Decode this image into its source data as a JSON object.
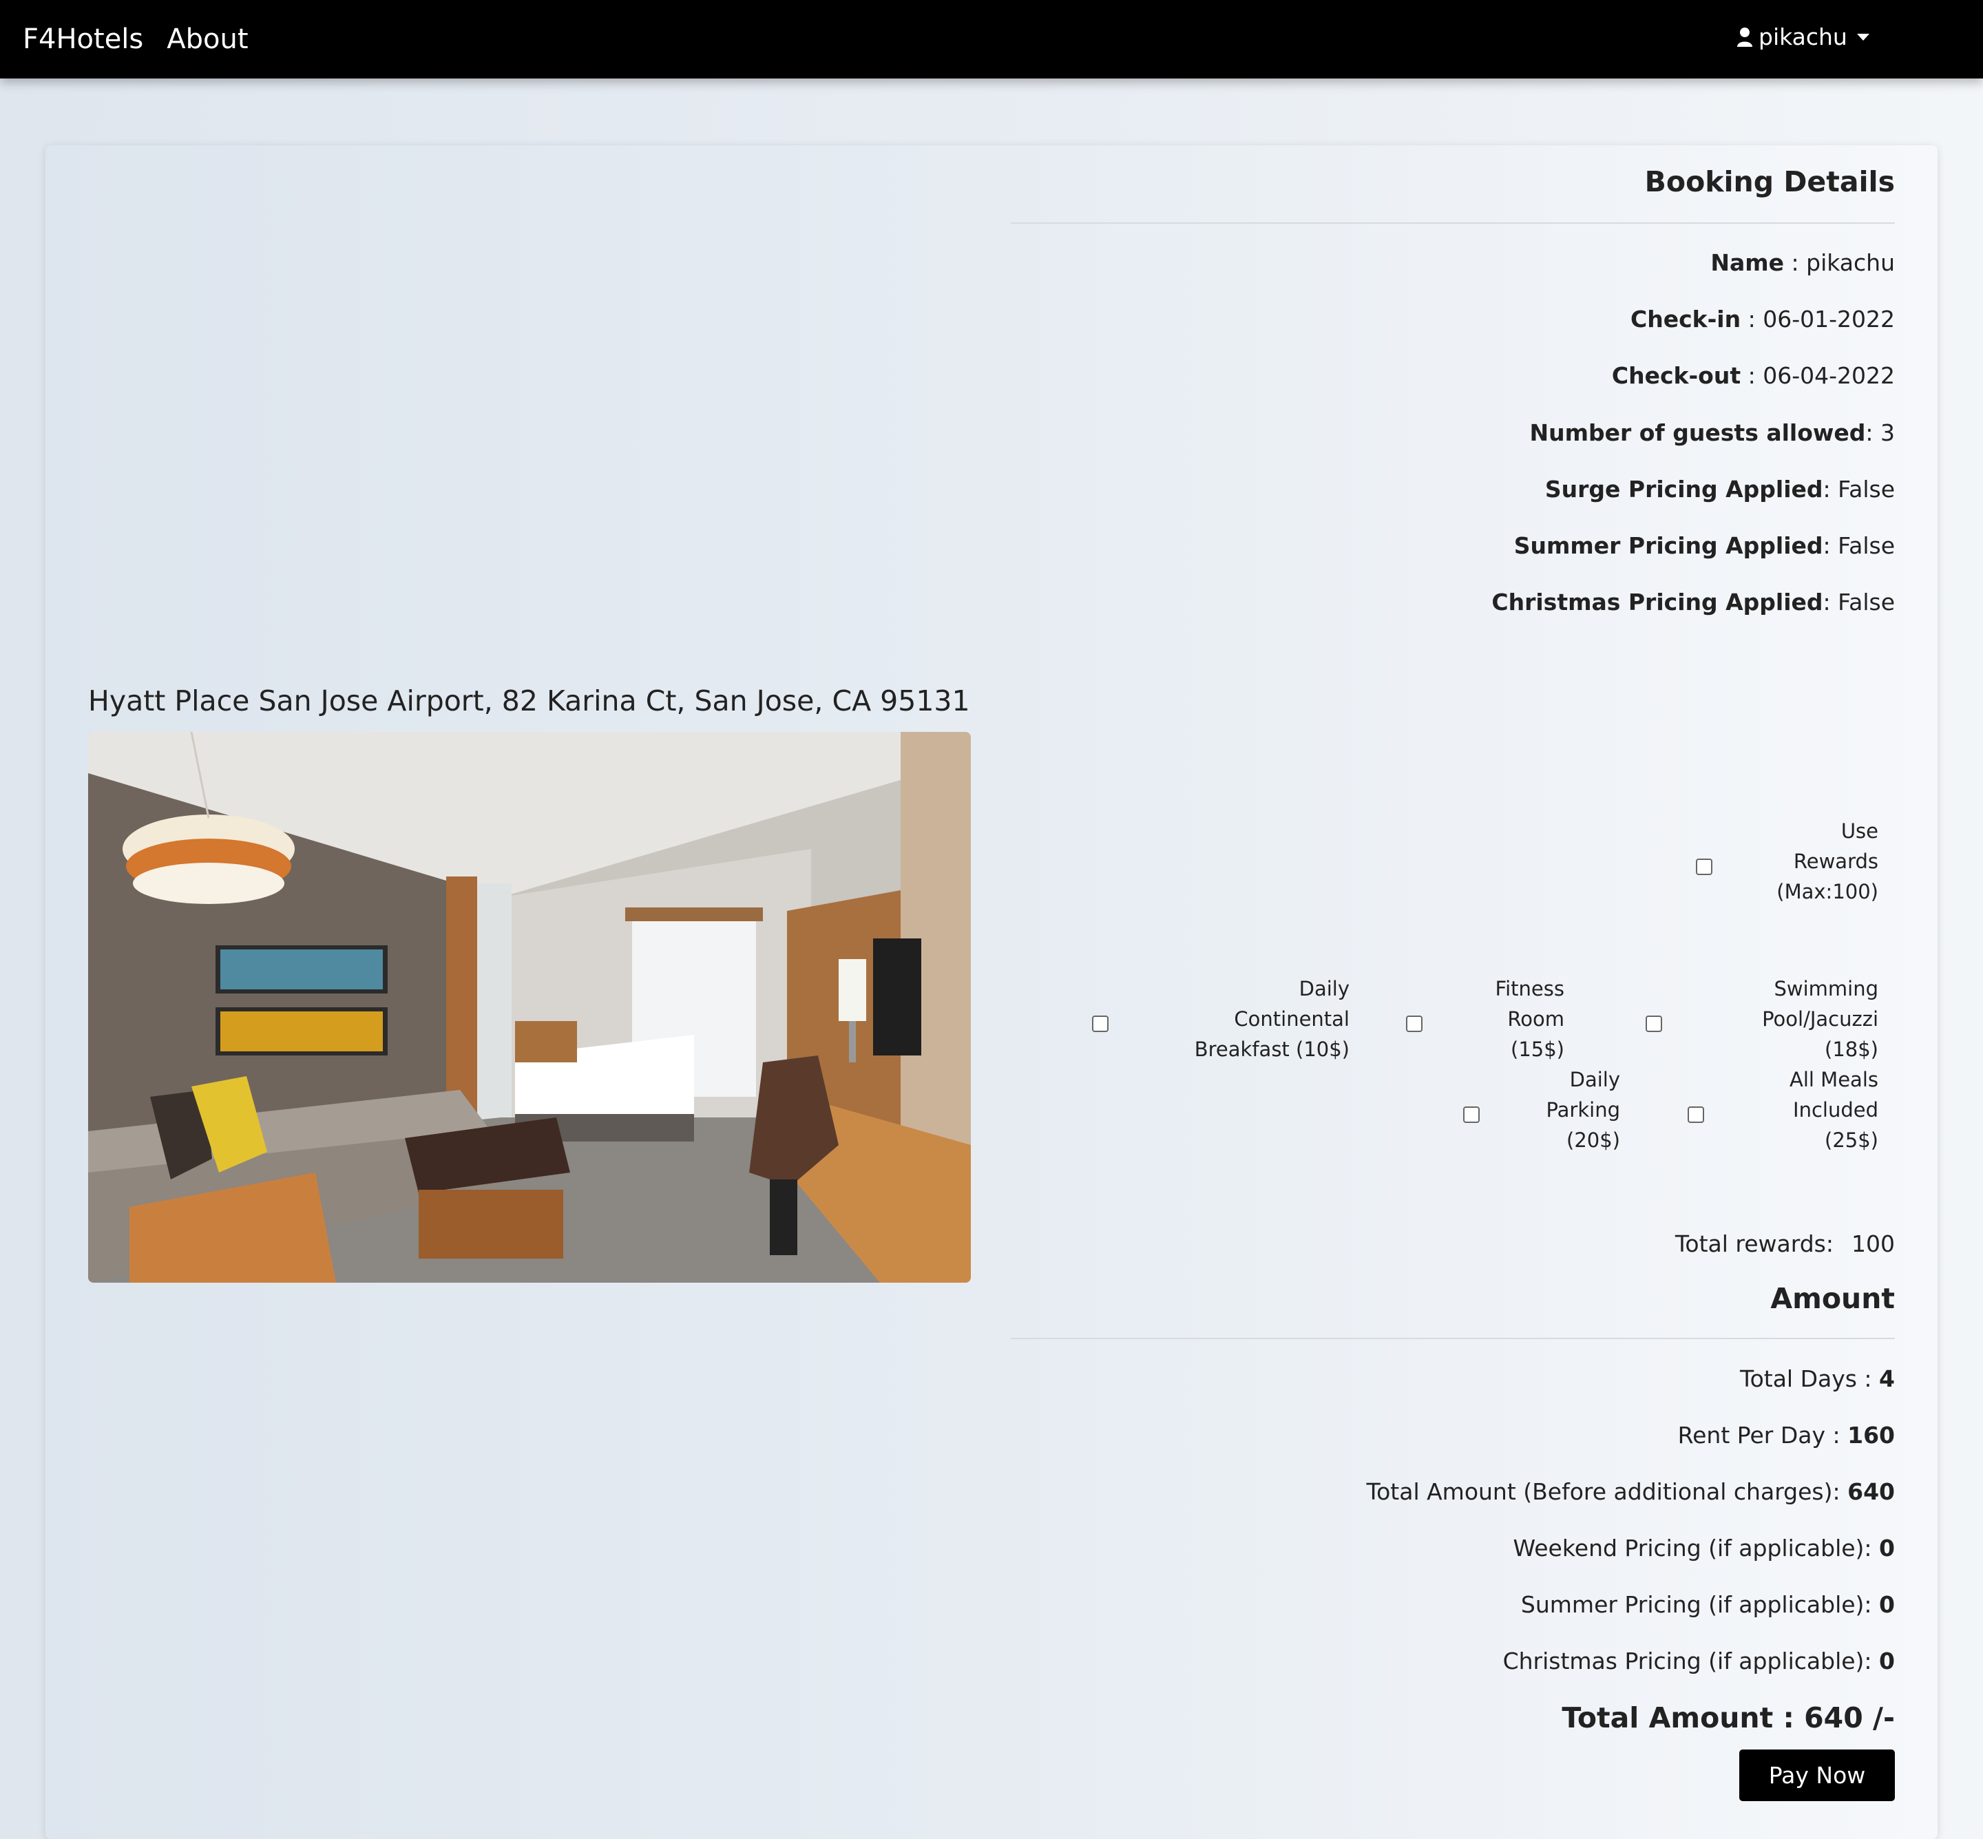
{
  "nav": {
    "brand": "F4Hotels",
    "about": "About",
    "user": "pikachu"
  },
  "hotel": {
    "title": "Hyatt Place San Jose Airport, 82 Karina Ct, San Jose, CA 95131"
  },
  "booking": {
    "heading": "Booking Details",
    "name_label": "Name",
    "name_value": " : pikachu",
    "checkin_label": "Check-in",
    "checkin_value": " : 06-01-2022",
    "checkout_label": "Check-out",
    "checkout_value": " : 06-04-2022",
    "guests_label": "Number of guests allowed",
    "guests_value": ": 3",
    "surge_label": "Surge Pricing Applied",
    "surge_value": ": False",
    "summer_label": "Summer Pricing Applied",
    "summer_value": ": False",
    "christmas_label": "Christmas Pricing Applied",
    "christmas_value": ": False"
  },
  "options": {
    "rewards": [
      "Use",
      "Rewards",
      "(Max:100)"
    ],
    "breakfast": [
      "Daily",
      "Continental",
      "Breakfast (10$)"
    ],
    "fitness": [
      "Fitness",
      "Room",
      "(15$)"
    ],
    "pool": [
      "Swimming",
      "Pool/Jacuzzi",
      "(18$)"
    ],
    "parking": [
      "Daily",
      "Parking",
      "(20$)"
    ],
    "meals": [
      "All Meals",
      "Included",
      "(25$)"
    ]
  },
  "rewards": {
    "label": "Total rewards:",
    "value": "100"
  },
  "amount": {
    "heading": "Amount",
    "days_label": "Total Days : ",
    "days_value": "4",
    "rent_label": "Rent Per Day : ",
    "rent_value": "160",
    "total_before_label": "Total Amount (Before additional charges): ",
    "total_before_value": "640",
    "weekend_label": "Weekend Pricing (if applicable): ",
    "weekend_value": "0",
    "summer_label": "Summer Pricing (if applicable): ",
    "summer_value": "0",
    "christmas_label": "Christmas Pricing (if applicable): ",
    "christmas_value": "0",
    "grand_total": "Total Amount : 640 /-",
    "pay_button": "Pay Now"
  }
}
